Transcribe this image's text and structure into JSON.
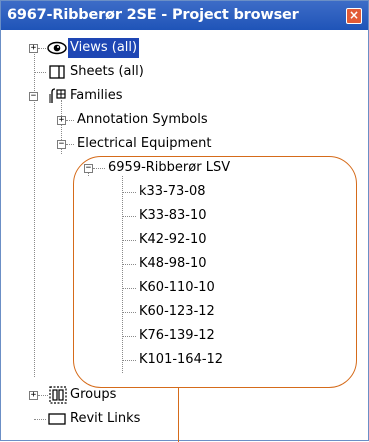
{
  "window": {
    "title": "6967-Ribberør 2SE - Project browser",
    "close_glyph": "×"
  },
  "tree": {
    "views": {
      "label": "Views (all)",
      "expander": "+",
      "icon": "eye-icon",
      "selected": true
    },
    "sheets": {
      "label": "Sheets (all)",
      "icon": "sheets-icon"
    },
    "families": {
      "label": "Families",
      "expander": "−",
      "icon": "families-icon",
      "children": {
        "annotation_symbols": {
          "label": "Annotation Symbols",
          "expander": "+"
        },
        "electrical_equipment": {
          "label": "Electrical Equipment",
          "expander": "−",
          "family": {
            "label": "6959-Ribberør LSV",
            "expander": "−",
            "types": [
              "k33-73-08",
              "K33-83-10",
              "K42-92-10",
              "K48-98-10",
              "K60-110-10",
              "K60-123-12",
              "K76-139-12",
              "K101-164-12"
            ]
          }
        }
      }
    },
    "groups": {
      "label": "Groups",
      "expander": "+",
      "icon": "groups-icon"
    },
    "revit_links": {
      "label": "Revit Links",
      "icon": "revit-links-icon"
    }
  },
  "colors": {
    "accent": "#1e46b4",
    "annotation": "#d56b1a",
    "titlebar": "#2a5cbf"
  }
}
